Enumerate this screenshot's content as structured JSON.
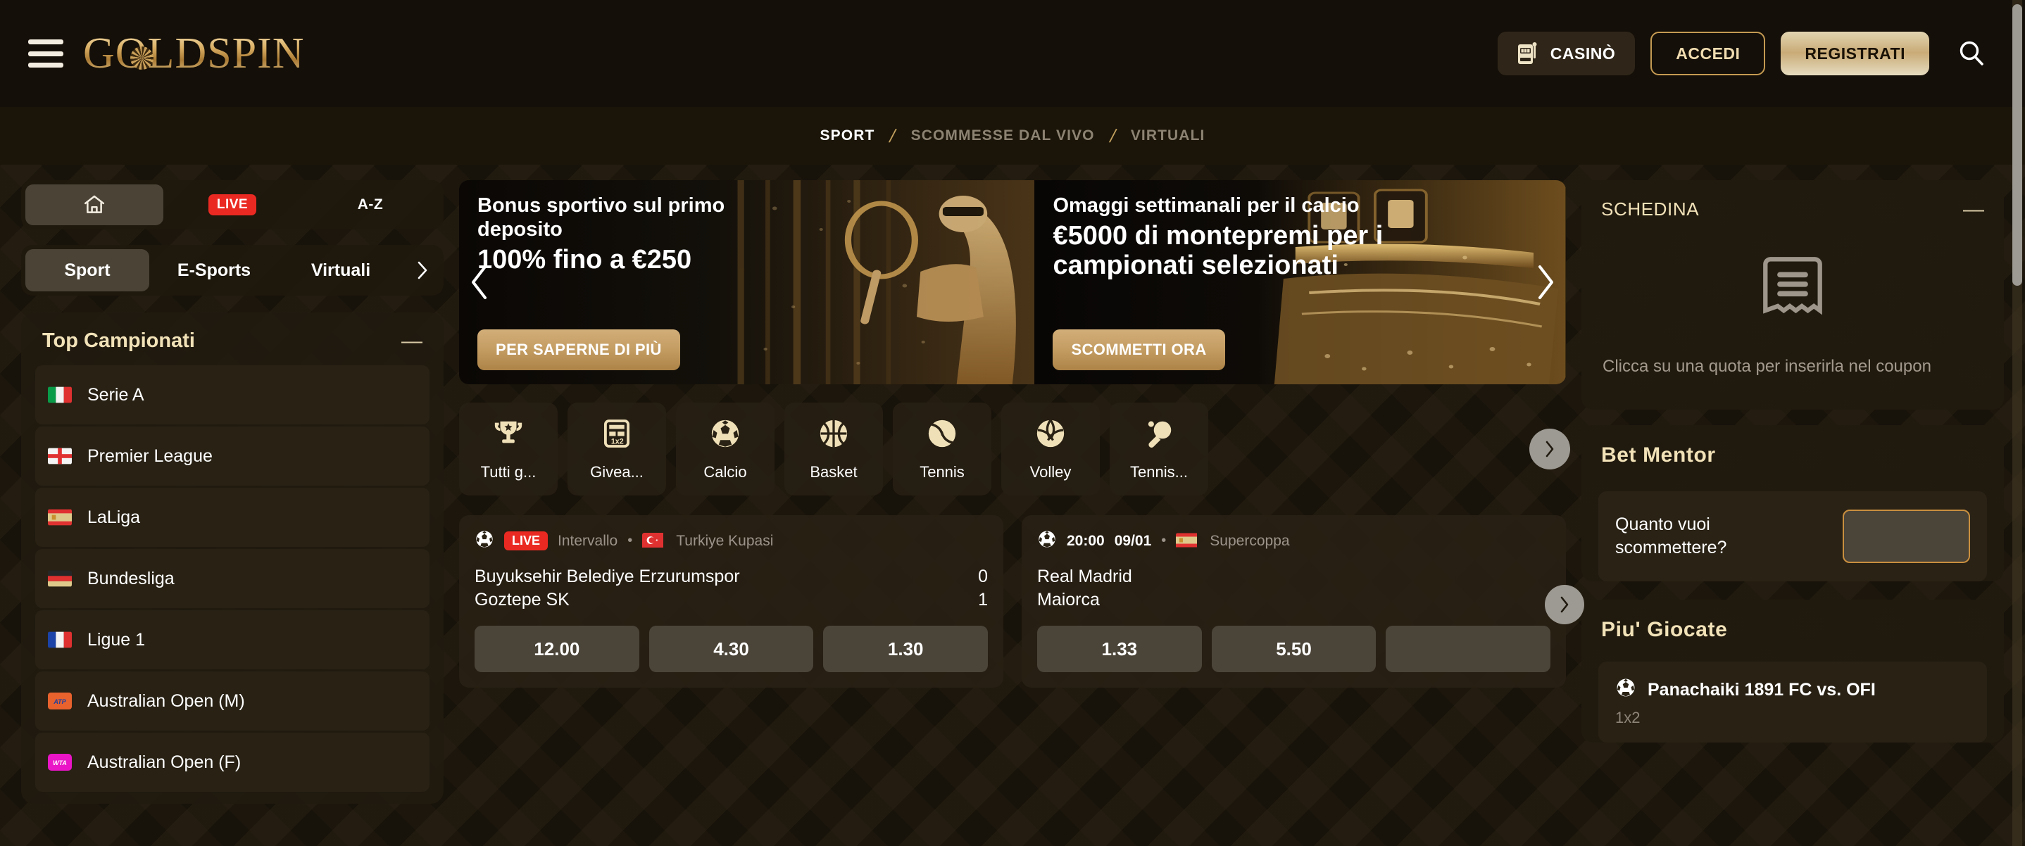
{
  "header": {
    "menu_icon": "hamburger-icon",
    "logo_text": "GOLDSPIN",
    "casino_label": "CASINÒ",
    "login_label": "ACCEDI",
    "register_label": "REGISTRATI",
    "search_icon": "search-icon"
  },
  "subnav": {
    "items": [
      {
        "label": "SPORT",
        "active": true
      },
      {
        "label": "SCOMMESSE DAL VIVO",
        "active": false
      },
      {
        "label": "VIRTUALI",
        "active": false
      }
    ],
    "separator": "/"
  },
  "sidebar": {
    "icon_tabs": [
      {
        "name": "home-icon",
        "label": ""
      },
      {
        "name": "live-badge",
        "label": "LIVE"
      },
      {
        "name": "az-sort",
        "label": "A-Z"
      }
    ],
    "text_tabs": [
      {
        "label": "Sport",
        "active": true
      },
      {
        "label": "E-Sports",
        "active": false
      },
      {
        "label": "Virtuali",
        "active": false
      }
    ],
    "tabs_next_icon": "chevron-right-icon",
    "leagues": {
      "title": "Top Campionati",
      "collapse_icon": "minus-icon",
      "items": [
        {
          "label": "Serie A",
          "flag": "it"
        },
        {
          "label": "Premier League",
          "flag": "en"
        },
        {
          "label": "LaLiga",
          "flag": "es"
        },
        {
          "label": "Bundesliga",
          "flag": "de"
        },
        {
          "label": "Ligue 1",
          "flag": "fr"
        },
        {
          "label": "Australian Open (M)",
          "flag": "atp"
        },
        {
          "label": "Australian Open (F)",
          "flag": "wta"
        }
      ]
    }
  },
  "carousel": {
    "prev_icon": "chevron-left-icon",
    "next_icon": "chevron-right-icon",
    "slides": [
      {
        "subtitle": "Bonus sportivo sul primo deposito",
        "title": "100% fino a €250",
        "cta": "PER SAPERNE DI PIÙ"
      },
      {
        "subtitle": "Omaggi settimanali per il calcio",
        "title": "€5000 di montepremi per i campionati selezionati",
        "cta": "SCOMMETTI ORA"
      }
    ]
  },
  "sports": {
    "next_icon": "chevron-right-icon",
    "items": [
      {
        "label": "Tutti g...",
        "icon": "trophy-icon"
      },
      {
        "label": "Givea...",
        "icon": "coupon-1x2-icon"
      },
      {
        "label": "Calcio",
        "icon": "football-icon"
      },
      {
        "label": "Basket",
        "icon": "basketball-icon"
      },
      {
        "label": "Tennis",
        "icon": "tennis-ball-icon"
      },
      {
        "label": "Volley",
        "icon": "volleyball-icon"
      },
      {
        "label": "Tennis...",
        "icon": "table-tennis-icon"
      }
    ]
  },
  "matches": {
    "next_icon": "chevron-right-icon",
    "items": [
      {
        "sport_icon": "football-icon",
        "live": true,
        "live_label": "LIVE",
        "state": "Intervallo",
        "flag": "tr",
        "competition": "Turkiye Kupasi",
        "teams": [
          "Buyuksehir Belediye Erzurumspor",
          "Goztepe SK"
        ],
        "scores": [
          "0",
          "1"
        ],
        "odds": [
          "12.00",
          "4.30",
          "1.30"
        ]
      },
      {
        "sport_icon": "football-icon",
        "live": false,
        "time": "20:00",
        "date": "09/01",
        "flag": "es",
        "competition": "Supercoppa",
        "teams": [
          "Real Madrid",
          "Maiorca"
        ],
        "scores": [
          "",
          ""
        ],
        "odds": [
          "1.33",
          "5.50",
          ""
        ]
      }
    ]
  },
  "betslip": {
    "title": "SCHEDINA",
    "collapse_icon": "minus-icon",
    "empty_icon": "receipt-icon",
    "empty_message": "Clicca su una quota per inserirla nel coupon"
  },
  "bet_mentor": {
    "title": "Bet Mentor",
    "stake_label": "Quanto vuoi scommettere?",
    "stake_value": "",
    "stake_placeholder": ""
  },
  "popular": {
    "title": "Piu' Giocate",
    "items": [
      {
        "icon": "football-icon",
        "match": "Panachaiki 1891 FC vs. OFI",
        "market": "1x2"
      }
    ]
  },
  "colors": {
    "background": "#17120a",
    "header_bg": "#140f08",
    "gold": "#c9a55f",
    "gold_text": "#f2e2b8",
    "live_red": "#ea2a22",
    "panel": "#231c10",
    "odd_bg": "#4b4438"
  }
}
